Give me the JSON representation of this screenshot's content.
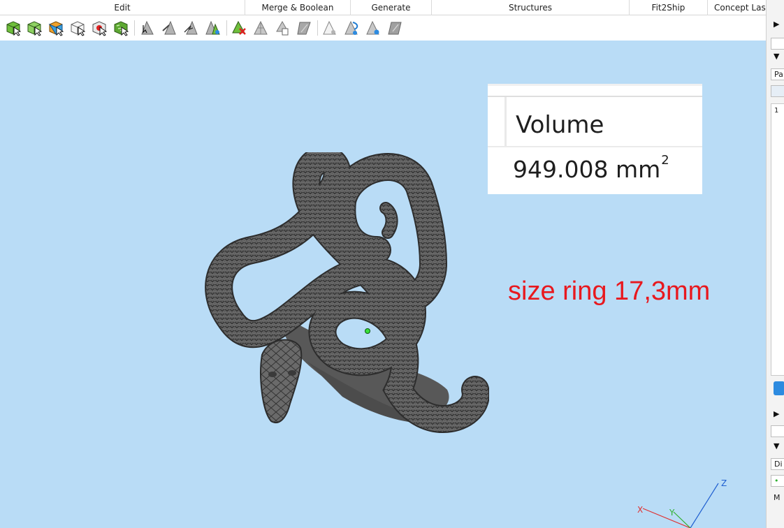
{
  "ribbon": {
    "groups": {
      "edit": "Edit",
      "merge_boolean": "Merge & Boolean",
      "generate": "Generate",
      "structures": "Structures",
      "fit2ship": "Fit2Ship",
      "concept_laser": "Concept Laser"
    }
  },
  "toolbar": {
    "icons": [
      "select-part-icon",
      "select-green-part-icon",
      "select-orange-part-icon",
      "select-white-part-icon",
      "select-red-part-icon",
      "select-patch-part-icon",
      "triangle-select-icon",
      "triangle-brush-icon",
      "triangle-lasso-icon",
      "triangle-marked-icon",
      "triangle-delete-icon",
      "triangle-split-icon",
      "triangle-copy-icon",
      "triangle-invert-icon",
      "shell-select-icon",
      "shell-move-icon",
      "shell-view-icon",
      "shell-gray-icon"
    ]
  },
  "viewport": {
    "volume_panel": {
      "header": "Volume",
      "value": "949.008 mm",
      "superscript": "2"
    },
    "annotation": "size ring 17,3mm",
    "axes": {
      "x": "X",
      "y": "Y",
      "z": "Z"
    }
  },
  "right_panel": {
    "field_1": "Pa",
    "list_row_1": "1",
    "field_2": "Di",
    "field_3": "M"
  },
  "colors": {
    "viewport_bg": "#b9dcf6",
    "annotation": "#e8181e",
    "model": "#5d5d5d"
  }
}
